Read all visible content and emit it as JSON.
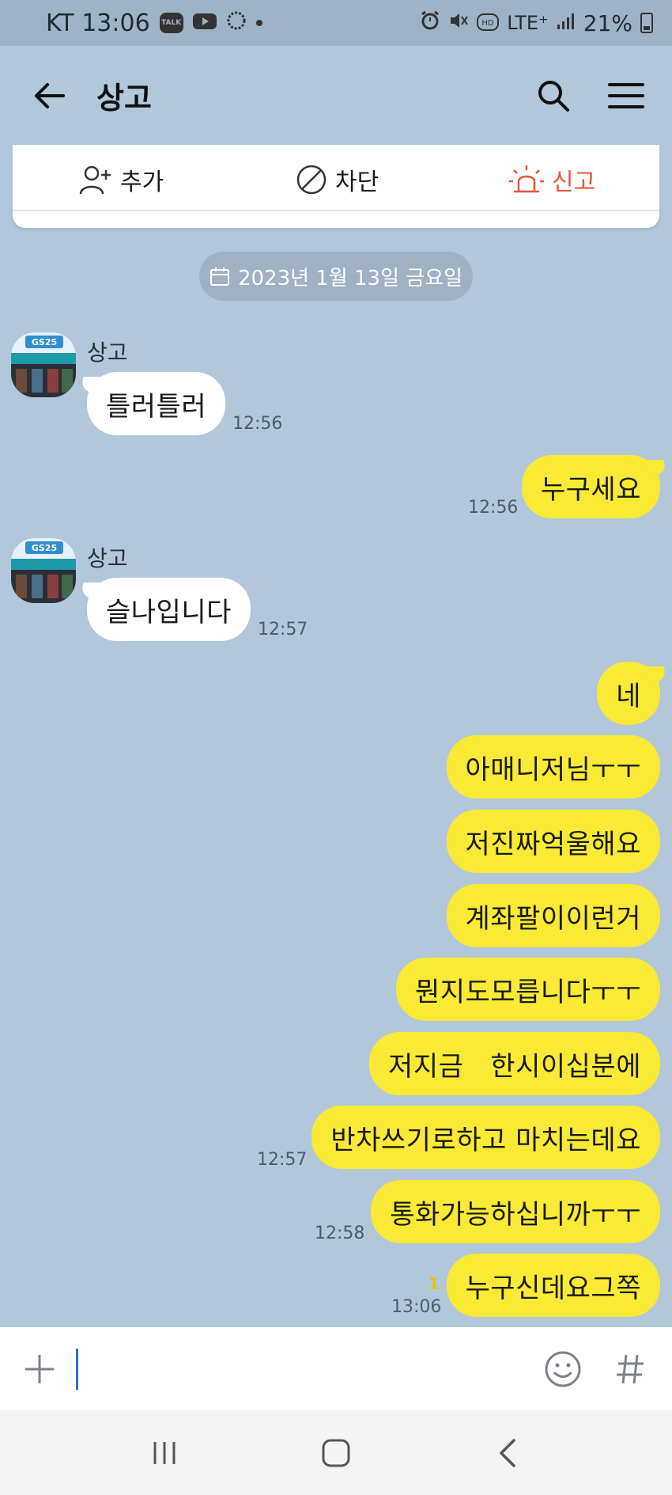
{
  "status_bar": {
    "carrier_time": "KT 13:06",
    "talk_icon_label": "TALK",
    "network": "LTE⁺",
    "battery": "21%"
  },
  "header": {
    "title": "상고"
  },
  "actions": {
    "add_label": "추가",
    "block_label": "차단",
    "report_label": "신고"
  },
  "date_divider": "2023년 1월 13일 금요일",
  "messages": [
    {
      "side": "in",
      "sender": "상고",
      "text": "틀러틀러",
      "time": "12:56"
    },
    {
      "side": "out",
      "text": "누구세요",
      "time": "12:56"
    },
    {
      "side": "in",
      "sender": "상고",
      "text": "슬나입니다",
      "time": "12:57"
    },
    {
      "side": "out",
      "text": "네"
    },
    {
      "side": "out",
      "text": "아매니저님ㅜㅜ"
    },
    {
      "side": "out",
      "text": "저진짜억울해요"
    },
    {
      "side": "out",
      "text": "계좌팔이이런거"
    },
    {
      "side": "out",
      "text": "뭔지도모릅니다ㅜㅜ"
    },
    {
      "side": "out",
      "text": "저지금   한시이십분에"
    },
    {
      "side": "out",
      "text": "반차쓰기로하고 마치는데요",
      "time": "12:57"
    },
    {
      "side": "out",
      "text": "통화가능하십니까ㅜㅜ",
      "time": "12:58"
    },
    {
      "side": "out",
      "text": "누구신데요그쪽",
      "time": "13:06",
      "unread": "1"
    }
  ],
  "input": {
    "value": ""
  },
  "colors": {
    "chat_background": "#b2c7da",
    "outgoing_bubble": "#fae935",
    "incoming_bubble": "#ffffff",
    "report_accent": "#e8553a"
  }
}
